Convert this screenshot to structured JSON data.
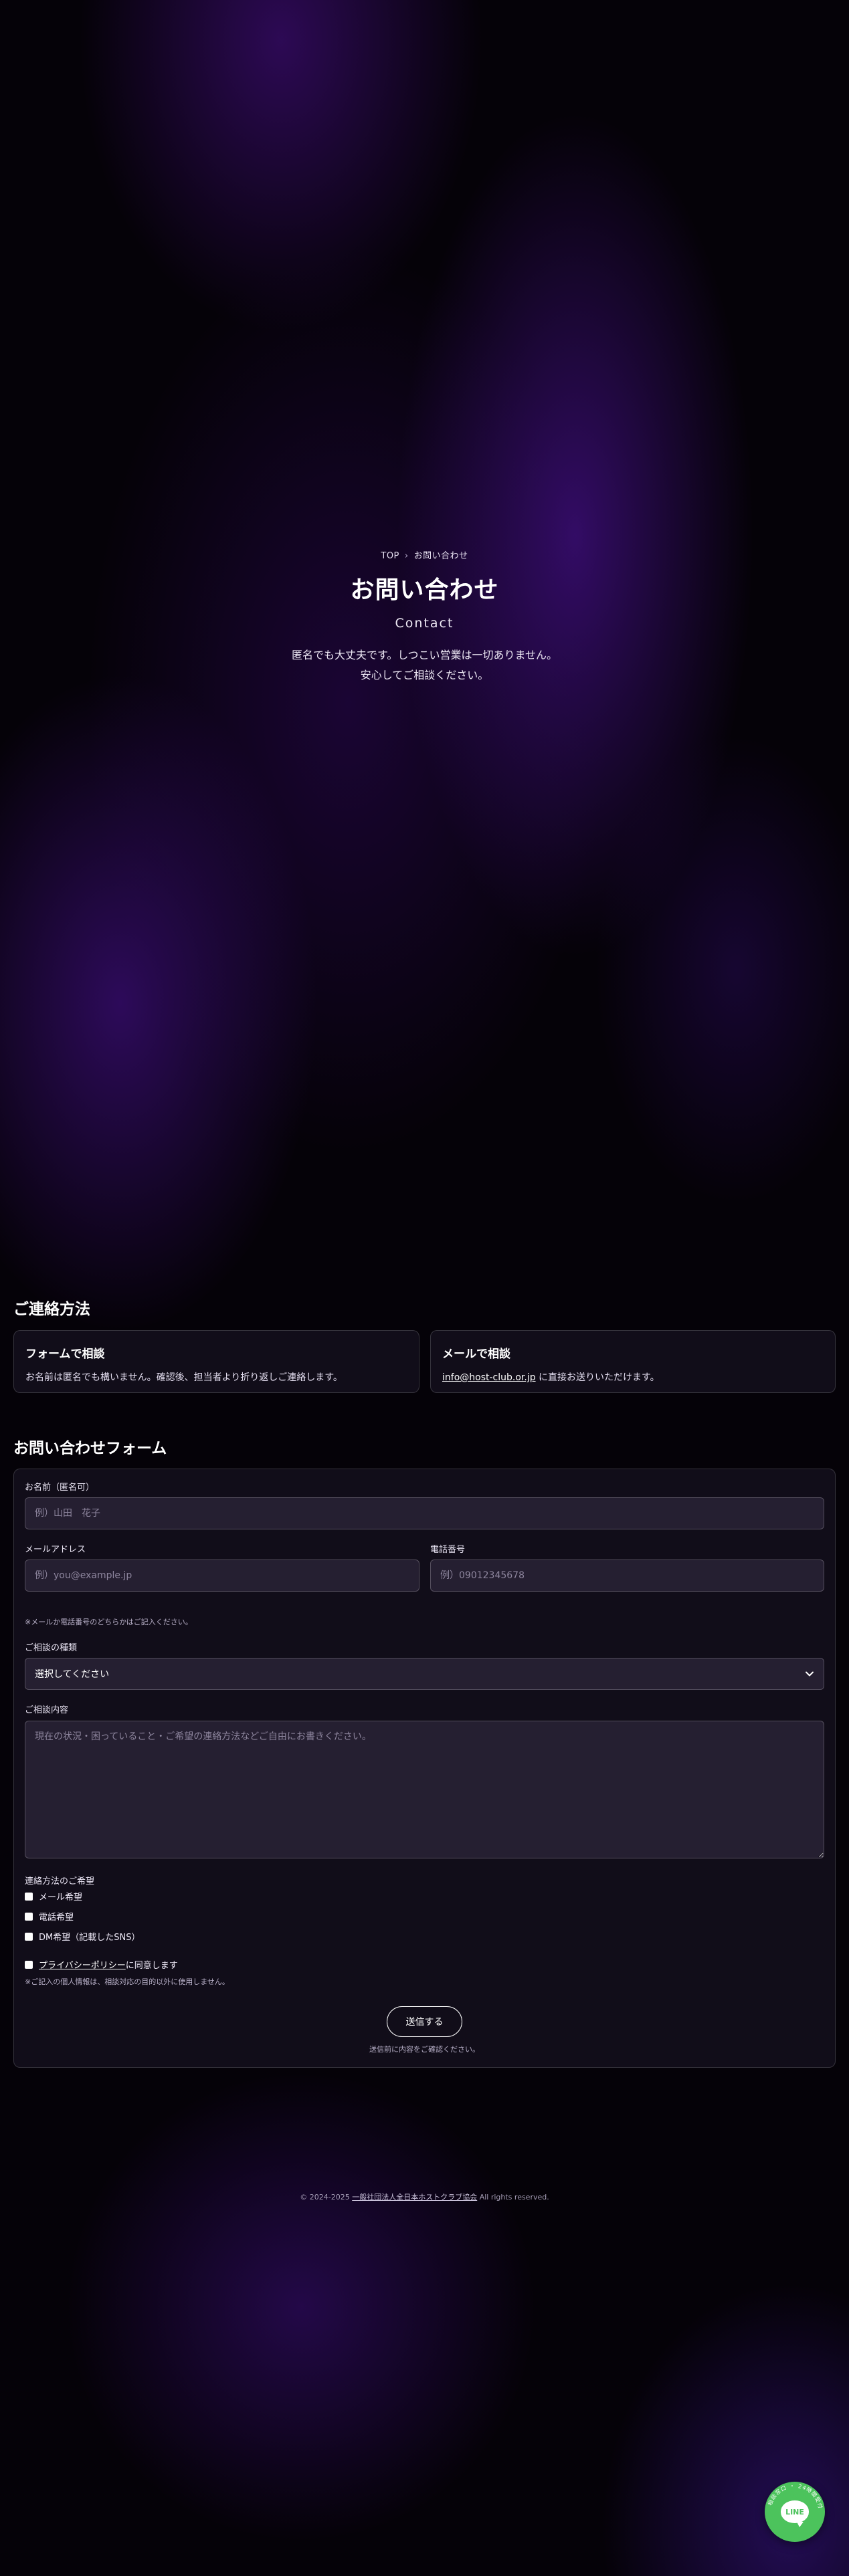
{
  "breadcrumb": {
    "home": "TOP",
    "separator": "›",
    "current": "お問い合わせ"
  },
  "hero": {
    "title": "お問い合わせ",
    "subtitle": "Contact",
    "lead_line1": "匿名でも大丈夫です。しつこい営業は一切ありません。",
    "lead_line2": "安心してご相談ください。"
  },
  "methods": {
    "title": "ご連絡方法",
    "form": {
      "title": "フォームで相談",
      "text": "お名前は匿名でも構いません。確認後、担当者より折り返しご連絡します。"
    },
    "email": {
      "title": "メールで相談",
      "address": "info@host-club.or.jp",
      "text": " に直接お送りいただけます。"
    }
  },
  "form": {
    "title": "お問い合わせフォーム",
    "name_label": "お名前（匿名可）",
    "name_placeholder": "例）山田　花子",
    "email_label": "メールアドレス",
    "email_placeholder": "例）you@example.jp",
    "phone_label": "電話番号",
    "phone_placeholder": "例）09012345678",
    "contact_note": "※メールか電話番号のどちらかはご記入ください。",
    "type_label": "ご相談の種類",
    "type_selected": "選択してください",
    "message_label": "ご相談内容",
    "message_placeholder": "現在の状況・困っていること・ご希望の連絡方法などご自由にお書きください。",
    "pref_label": "連絡方法のご希望",
    "pref_options": [
      "メール希望",
      "電話希望",
      "DM希望（記載したSNS）"
    ],
    "privacy_link": "プライバシーポリシー",
    "privacy_suffix": " に同意します",
    "privacy_note": "※ご記入の個人情報は、相談対応の目的以外に使用しません。",
    "submit_label": "送信する",
    "submit_note": "送信前に内容をご確認ください。"
  },
  "footer": {
    "prefix": "© 2024-2025 ",
    "org": "一般社団法人全日本ホストクラブ協会",
    "suffix": " All rights reserved."
  },
  "line_button": {
    "logo_text": "LINE",
    "ring_text": "相談窓口 ・ 24時間受付"
  },
  "colors": {
    "accent_purple": "#3a0c6e",
    "line_green": "#4cc35c",
    "background": "#050208"
  }
}
